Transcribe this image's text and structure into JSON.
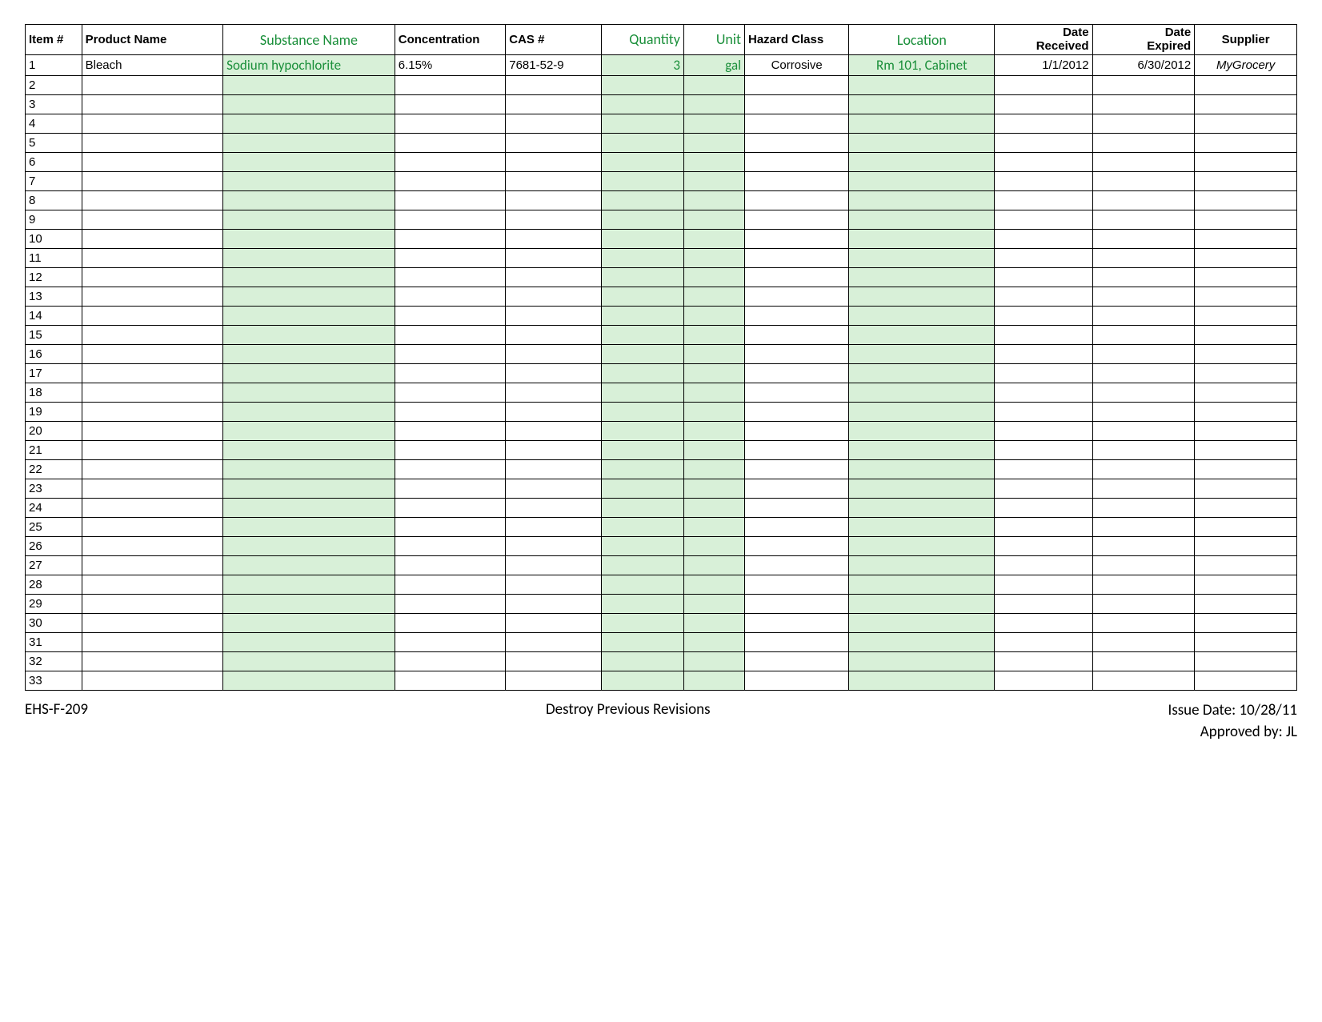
{
  "columns": [
    {
      "key": "item",
      "label": "Item #",
      "green": false,
      "align": "left"
    },
    {
      "key": "product",
      "label": "Product Name",
      "green": false,
      "align": "left"
    },
    {
      "key": "substance",
      "label": "Substance Name",
      "green": true,
      "align": "center"
    },
    {
      "key": "concentration",
      "label": "Concentration",
      "green": false,
      "align": "left"
    },
    {
      "key": "cas",
      "label": "CAS #",
      "green": false,
      "align": "left"
    },
    {
      "key": "quantity",
      "label": "Quantity",
      "green": true,
      "align": "right"
    },
    {
      "key": "unit",
      "label": "Unit",
      "green": true,
      "align": "right"
    },
    {
      "key": "hazard",
      "label": "Hazard Class",
      "green": false,
      "align": "left"
    },
    {
      "key": "location",
      "label": "Location",
      "green": true,
      "align": "center"
    },
    {
      "key": "date_received",
      "label": "Date Received",
      "green": false,
      "align": "right",
      "twoLine": [
        "Date",
        "Received"
      ]
    },
    {
      "key": "date_expired",
      "label": "Date Expired",
      "green": false,
      "align": "right",
      "twoLine": [
        "Date",
        "Expired"
      ]
    },
    {
      "key": "supplier",
      "label": "Supplier",
      "green": false,
      "align": "center"
    }
  ],
  "green_fill_keys": [
    "substance",
    "quantity",
    "unit",
    "location"
  ],
  "row_count": 33,
  "rows": [
    {
      "item": "1",
      "product": "Bleach",
      "substance": "Sodium hypochlorite",
      "concentration": "6.15%",
      "cas": "7681-52-9",
      "quantity": "3",
      "unit": "gal",
      "hazard": "Corrosive",
      "location": "Rm 101, Cabinet",
      "date_received": "1/1/2012",
      "date_expired": "6/30/2012",
      "supplier": "MyGrocery"
    }
  ],
  "cell_align": {
    "item": "left",
    "product": "left",
    "substance": "left",
    "concentration": "left",
    "cas": "left",
    "quantity": "right",
    "unit": "right",
    "hazard": "center",
    "location": "center",
    "date_received": "right",
    "date_expired": "right",
    "supplier": "center"
  },
  "italic_keys": [
    "supplier"
  ],
  "footer": {
    "form_id": "EHS-F-209",
    "center_text": "Destroy Previous Revisions",
    "issue_date_label": "Issue Date:",
    "issue_date": "10/28/11",
    "approved_label": "Approved by:",
    "approved_by": "JL"
  }
}
